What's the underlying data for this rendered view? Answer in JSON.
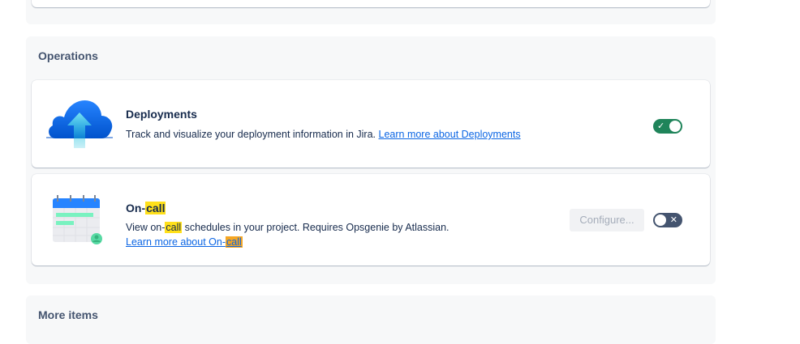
{
  "sections": {
    "operations": {
      "title": "Operations"
    },
    "more": {
      "title": "More items"
    }
  },
  "deployments": {
    "title": "Deployments",
    "desc": "Track and visualize your deployment information in Jira.",
    "link": "Learn more about Deployments",
    "icon": "cloud-upload-icon",
    "enabled": true
  },
  "oncall": {
    "title_prefix": "On-",
    "title_highlight": "call",
    "desc_prefix": "View on-",
    "desc_highlight": "call",
    "desc_suffix": " schedules in your project. Requires Opsgenie by Atlassian.",
    "link_prefix": "Learn more about On-",
    "link_highlight": "call",
    "icon": "calendar-icon",
    "configure_label": "Configure...",
    "enabled": false
  },
  "colors": {
    "toggle_on": "#1F845A",
    "toggle_off": "#44546F",
    "link": "#0C66E4",
    "highlight": "#FFE01A",
    "highlight_active": "#F5A623"
  }
}
